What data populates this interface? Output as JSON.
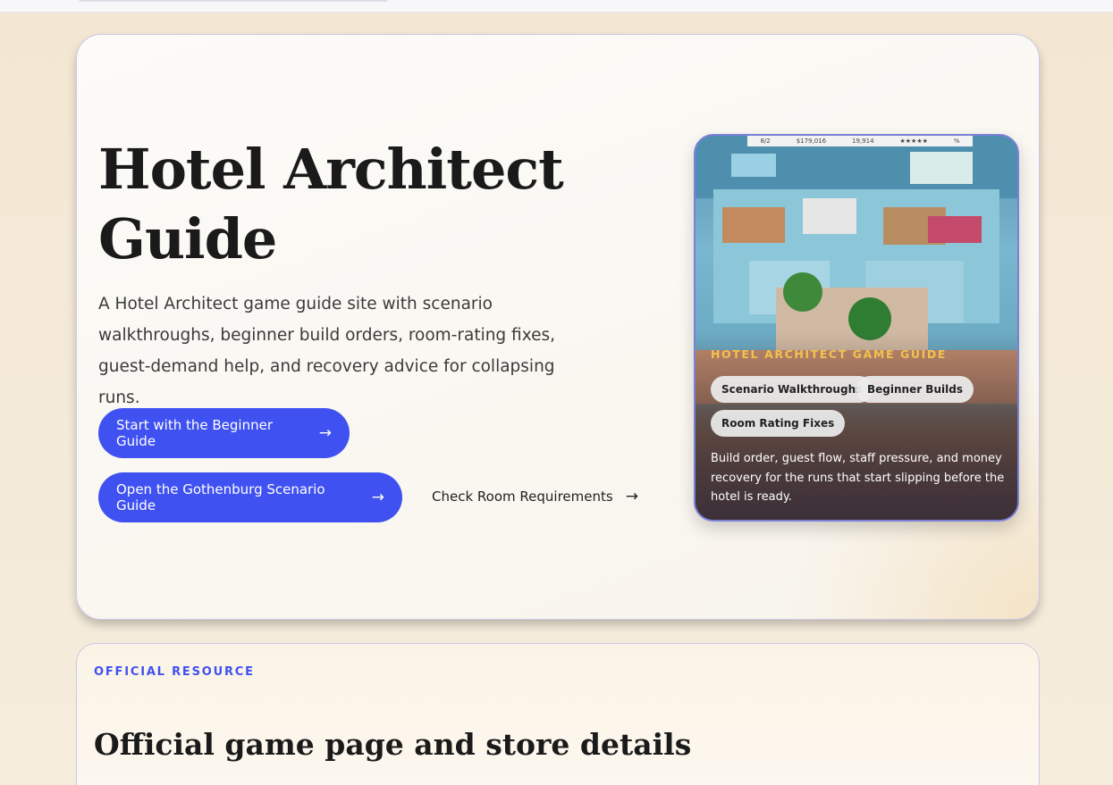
{
  "hero": {
    "title": "Hotel Architect Guide",
    "description": "A Hotel Architect game guide site with scenario walkthroughs, beginner build orders, room-rating fixes, guest-demand help, and recovery advice for collapsing runs.",
    "primary_button": "Start with the Beginner Guide",
    "secondary_button": "Open the Gothenburg Scenario Guide",
    "link": "Check Room Requirements",
    "arrow": "→"
  },
  "card": {
    "hud": [
      "8/2",
      "$179,016",
      "19,914",
      "★★★★★",
      "%"
    ],
    "label": "HOTEL ARCHITECT GAME GUIDE",
    "chips": [
      "Scenario Walkthroughs",
      "Beginner Builds",
      "Room Rating Fixes"
    ],
    "description": "Build order, guest flow, staff pressure, and money recovery for the runs that start slipping before the hotel is ready."
  },
  "section": {
    "eyebrow": "OFFICIAL RESOURCE",
    "title": "Official game page and store details"
  },
  "colors": {
    "accent": "#3f51f0",
    "gold": "#f2c14e",
    "background": "#f3e7d3"
  }
}
